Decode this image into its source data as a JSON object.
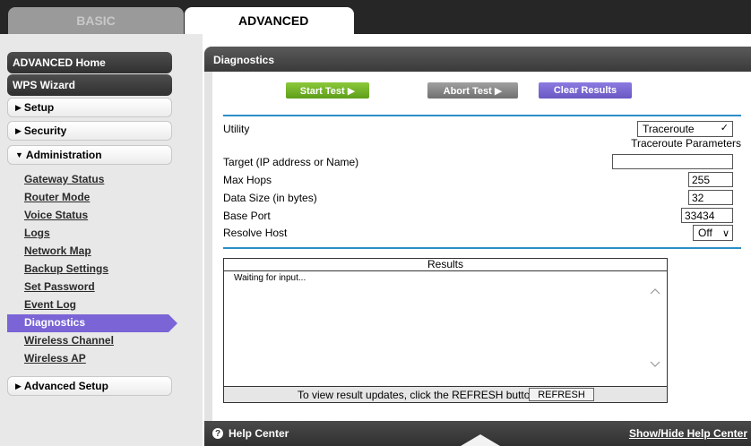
{
  "tabs": {
    "basic": "BASIC",
    "advanced": "ADVANCED"
  },
  "sidebar": {
    "advanced_home": "ADVANCED Home",
    "wps_wizard": "WPS Wizard",
    "setup": "Setup",
    "security": "Security",
    "administration": "Administration",
    "admin_items": [
      "Gateway Status",
      "Router Mode",
      "Voice Status",
      "Logs",
      "Network Map",
      "Backup Settings",
      "Set Password",
      "Event Log",
      "Diagnostics",
      "Wireless Channel",
      "Wireless AP"
    ],
    "advanced_setup": "Advanced Setup",
    "active_color": "#7a64d6"
  },
  "panel": {
    "title": "Diagnostics",
    "buttons": {
      "start": "Start Test ▶",
      "abort": "Abort Test ▶",
      "clear": "Clear Results"
    },
    "utility_label": "Utility",
    "utility_value": "Traceroute",
    "params_header": "Traceroute Parameters",
    "fields": {
      "target_label": "Target (IP address or Name)",
      "target_value": "",
      "max_hops_label": "Max Hops",
      "max_hops_value": "255",
      "data_size_label": "Data Size (in bytes)",
      "data_size_value": "32",
      "base_port_label": "Base Port",
      "base_port_value": "33434",
      "resolve_label": "Resolve Host",
      "resolve_value": "Off"
    },
    "results": {
      "header": "Results",
      "text": "Waiting for input...",
      "footer_note": "To view result updates, click the REFRESH button.",
      "refresh": "REFRESH"
    }
  },
  "footer": {
    "help_center": "Help Center",
    "toggle": "Show/Hide Help Center"
  },
  "colors": {
    "accent_blue": "#2c8ec5",
    "start_green": "#6fae24",
    "clear_purple": "#7a64d6"
  }
}
